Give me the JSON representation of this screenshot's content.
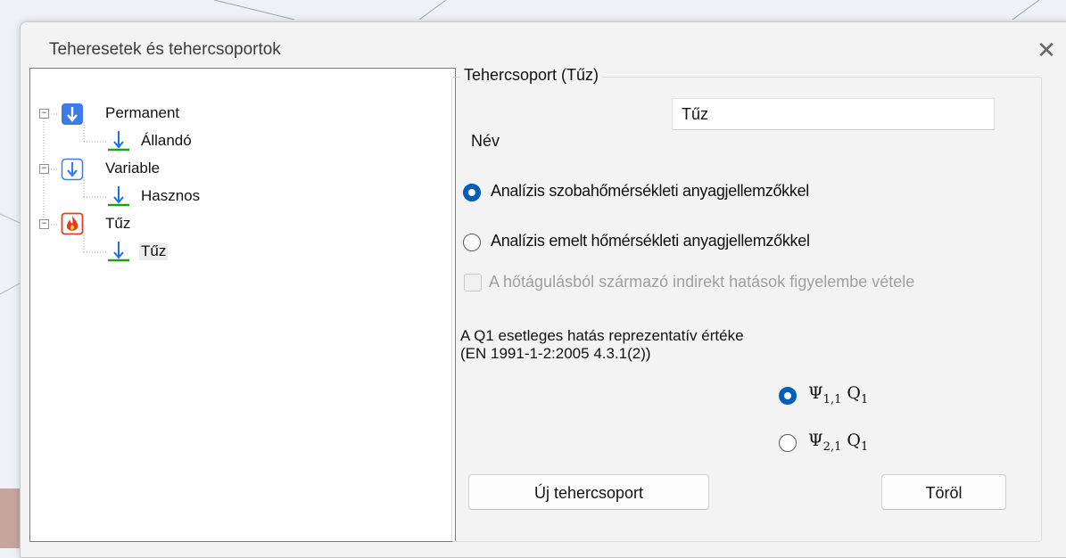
{
  "window": {
    "title": "Teheresetek és tehercsoportok",
    "close_glyph": "✕"
  },
  "tree": {
    "nodes": [
      {
        "label": "Permanent",
        "icon": "permanent-load-icon",
        "level": 0,
        "expander": "−"
      },
      {
        "label": "Állandó",
        "icon": "load-case-arrow-icon",
        "level": 1
      },
      {
        "label": "Variable",
        "icon": "variable-load-icon",
        "level": 0,
        "expander": "−"
      },
      {
        "label": "Hasznos",
        "icon": "load-case-arrow-icon",
        "level": 1
      },
      {
        "label": "Tűz",
        "icon": "fire-icon",
        "level": 0,
        "expander": "−"
      },
      {
        "label": "Tűz",
        "icon": "load-case-arrow-icon",
        "level": 1,
        "selected": true
      }
    ]
  },
  "group": {
    "title": "Tehercsoport (Tűz)",
    "name_label": "Név",
    "name_value": "Tűz",
    "analysis_options": [
      {
        "label": "Analízis szobahőmérsékleti anyagjellemzőkkel",
        "checked": true
      },
      {
        "label": "Analízis emelt hőmérsékleti anyagjellemzőkkel",
        "checked": false
      }
    ],
    "indirect_checkbox": {
      "label": "A hőtágulásból származó indirekt hatások figyelembe vétele",
      "checked": false,
      "disabled": true
    },
    "q1_text_line1": "A Q1 esetleges hatás reprezentatív értéke",
    "q1_text_line2": "(EN 1991-1-2:2005 4.3.1(2))",
    "psi_options": [
      {
        "symbol": "Ψ",
        "subscript": "1,1",
        "q": "Q",
        "q_sub": "1",
        "checked": true
      },
      {
        "symbol": "Ψ",
        "subscript": "2,1",
        "q": "Q",
        "q_sub": "1",
        "checked": false
      }
    ]
  },
  "buttons": {
    "new_group": "Új tehercsoport",
    "delete": "Töröl"
  },
  "colors": {
    "accent": "#005fb8",
    "load_arrow": "#1f6fe0",
    "ground_line": "#1aa31a",
    "fire": "#e0401e"
  }
}
